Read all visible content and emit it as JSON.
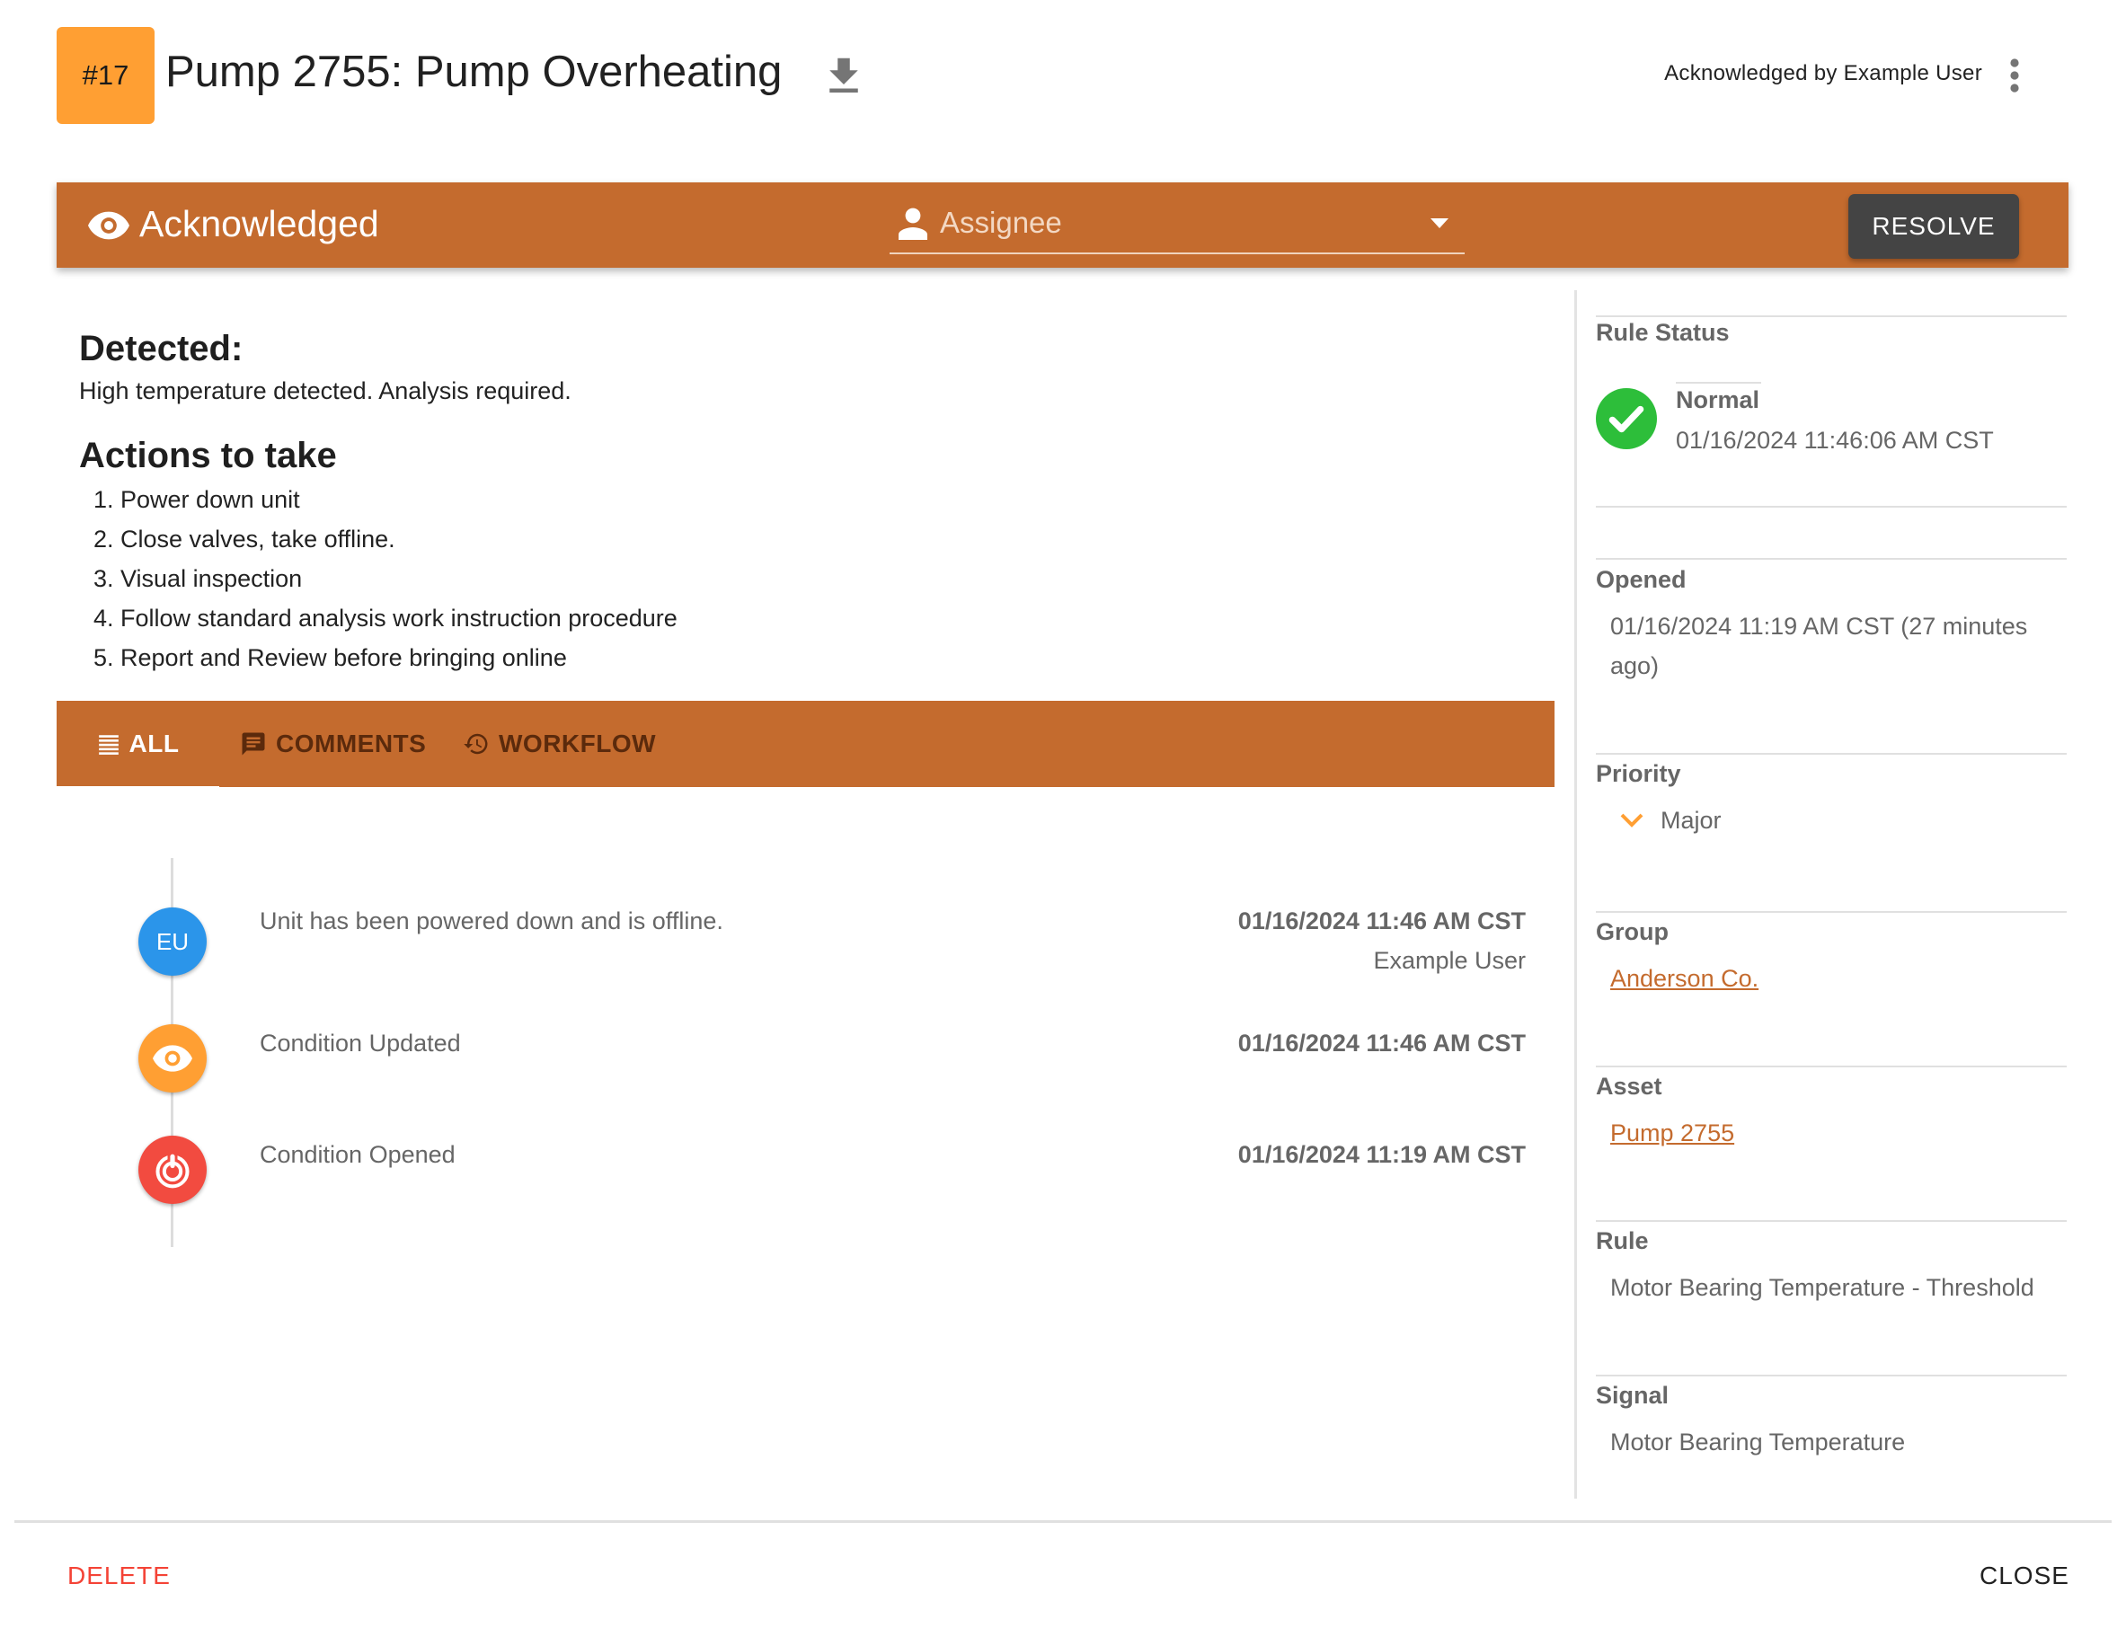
{
  "header": {
    "badge": "#17",
    "title": "Pump 2755: Pump Overheating",
    "download_icon": "download-icon",
    "acknowledged_by": "Acknowledged by Example User",
    "menu_icon": "more-vert-icon"
  },
  "status_bar": {
    "status_icon": "eye-icon",
    "status": "Acknowledged",
    "assignee_icon": "person-icon",
    "assignee_placeholder": "Assignee",
    "assignee_value": "",
    "resolve_label": "RESOLVE"
  },
  "description": {
    "detected_heading": "Detected:",
    "detected_text": "High temperature detected. Analysis required.",
    "actions_heading": "Actions to take",
    "actions": [
      "1. Power down unit",
      "2. Close valves, take offline.",
      "3. Visual inspection",
      "4. Follow standard analysis work instruction procedure",
      "5. Report and Review before bringing online"
    ]
  },
  "tabs": [
    {
      "label": "ALL",
      "icon": "list-icon",
      "active": true
    },
    {
      "label": "COMMENTS",
      "icon": "comment-icon",
      "active": false
    },
    {
      "label": "WORKFLOW",
      "icon": "history-icon",
      "active": false
    }
  ],
  "timeline": [
    {
      "avatar": "EU",
      "avatar_color": "#2B95EA",
      "text": "Unit has been powered down and is offline.",
      "time": "01/16/2024 11:46 AM CST",
      "user": "Example User"
    },
    {
      "avatar_icon": "eye-icon",
      "avatar_color": "#FF9F33",
      "text": "Condition Updated",
      "time": "01/16/2024 11:46 AM CST"
    },
    {
      "avatar_icon": "alarm-target-icon",
      "avatar_color": "#F24B40",
      "text": "Condition Opened",
      "time": "01/16/2024 11:19 AM CST"
    }
  ],
  "sidebar": {
    "rule_status": {
      "label": "Rule Status",
      "state": "Normal",
      "timestamp": "01/16/2024 11:46:06 AM CST",
      "icon": "check-circle-icon",
      "color": "#2DBE3A"
    },
    "opened": {
      "label": "Opened",
      "value": "01/16/2024 11:19 AM CST (27 minutes ago)"
    },
    "priority": {
      "label": "Priority",
      "value": "Major",
      "icon": "chevron-down-icon",
      "color": "#FF9F33"
    },
    "group": {
      "label": "Group",
      "value": "Anderson Co."
    },
    "asset": {
      "label": "Asset",
      "value": "Pump 2755"
    },
    "rule": {
      "label": "Rule",
      "value": "Motor Bearing Temperature - Threshold"
    },
    "signal": {
      "label": "Signal",
      "value": "Motor Bearing Temperature"
    }
  },
  "footer": {
    "delete_label": "DELETE",
    "close_label": "CLOSE"
  },
  "colors": {
    "brand_orange": "#C46B2E",
    "badge_orange": "#FF9F33",
    "resolve_bg": "#444444",
    "delete_red": "#F44336"
  }
}
